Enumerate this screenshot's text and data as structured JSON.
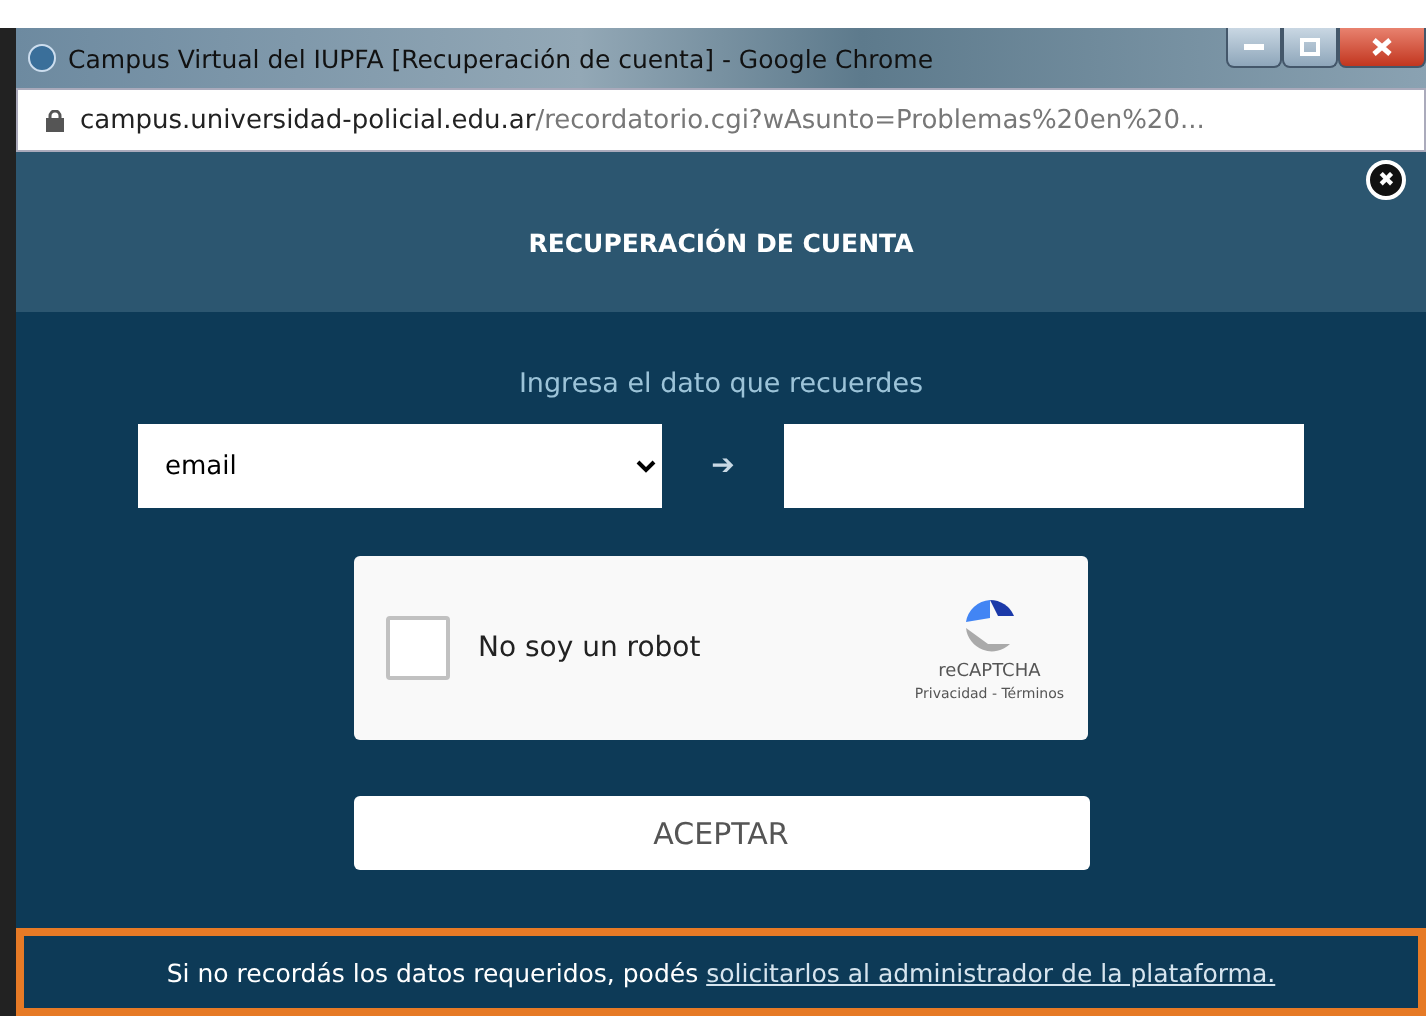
{
  "window": {
    "title": "Campus Virtual del IUPFA [Recuperación de cuenta] - Google Chrome"
  },
  "address_bar": {
    "host": "campus.universidad-policial.edu.ar",
    "path": "/recordatorio.cgi?wAsunto=Problemas%20en%20..."
  },
  "dialog": {
    "title": "RECUPERACIÓN DE CUENTA",
    "close_symbol": "✖",
    "prompt": "Ingresa el dato que recuerdes",
    "field_type": {
      "value": "email"
    },
    "arrow": "➔",
    "captcha": {
      "label": "No soy un robot",
      "checked": false,
      "brand": "reCAPTCHA",
      "links": "Privacidad - Términos"
    },
    "submit": "ACEPTAR"
  },
  "footer": {
    "text": "Si no recordás los datos requeridos, podés",
    "link": "solicitarlos al administrador de la plataforma."
  }
}
